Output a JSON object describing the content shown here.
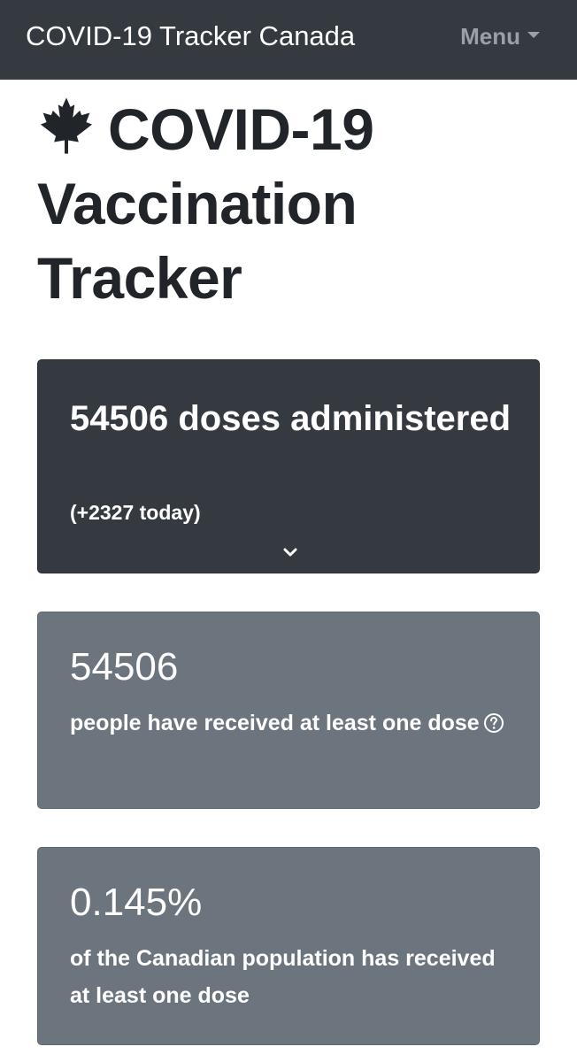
{
  "navbar": {
    "brand": "COVID-19 Tracker Canada",
    "menu_label": "Menu"
  },
  "page": {
    "title": "COVID-19 Vaccination Tracker"
  },
  "doses_card": {
    "headline": "54506 doses administered",
    "today": "(+2327 today)"
  },
  "people_card": {
    "value": "54506",
    "description": "people have received at least one dose"
  },
  "population_card": {
    "value": "0.145%",
    "description": "of the Canadian population has received at least one dose"
  },
  "icons": {
    "title_icon": "maple-leaf-icon",
    "menu_icon": "caret-down-icon",
    "expand_icon": "chevron-down-icon",
    "help_icon": "question-circle-icon"
  },
  "colors": {
    "navbar_bg": "#343a40",
    "dark_card_bg": "#343a40",
    "gray_card_bg": "#6c757d",
    "text_dark": "#212529",
    "text_light": "#ffffff",
    "menu_text": "#9aa0a6"
  }
}
